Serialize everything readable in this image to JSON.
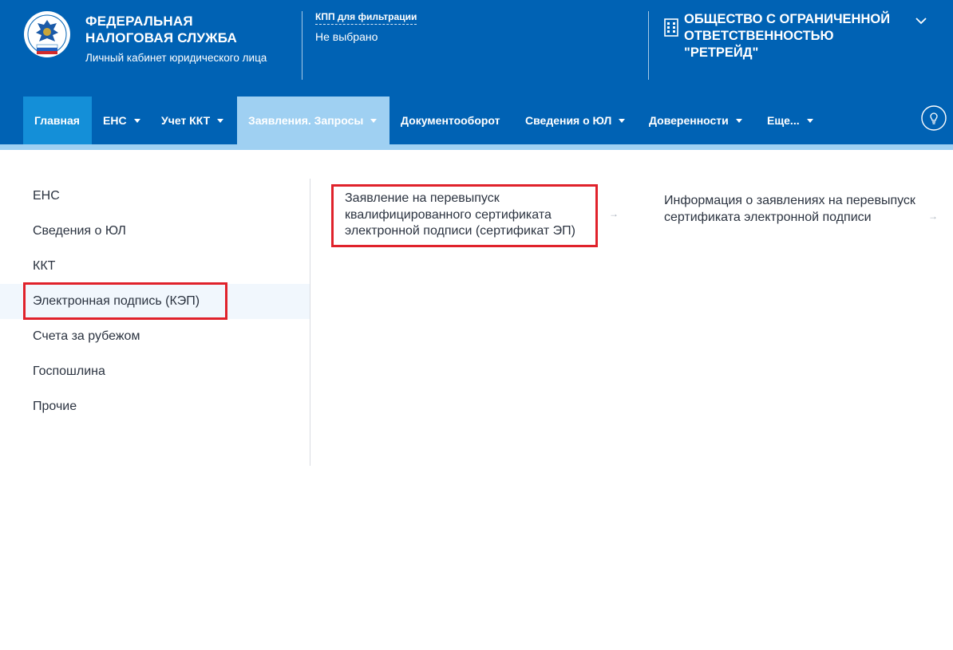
{
  "header": {
    "brand_title": "ФЕДЕРАЛЬНАЯ НАЛОГОВАЯ СЛУЖБА",
    "brand_subtitle": "Личный кабинет юридического лица",
    "kpp_label": "КПП для фильтрации",
    "kpp_value": "Не выбрано",
    "org_name": "ОБЩЕСТВО С ОГРАНИЧЕННОЙ ОТВЕТСТВЕННОСТЬЮ \"РЕТРЕЙД\"",
    "logo_icon": "fns-emblem-icon",
    "org_icon": "building-icon",
    "org_menu_icon": "chevron-down-icon"
  },
  "nav": {
    "items": [
      {
        "label": "Главная",
        "dropdown": false
      },
      {
        "label": "ЕНС",
        "dropdown": true
      },
      {
        "label": "Учет ККТ",
        "dropdown": true
      },
      {
        "label": "Заявления. Запросы",
        "dropdown": true
      },
      {
        "label": "Документооборот",
        "dropdown": false
      },
      {
        "label": "Сведения о ЮЛ",
        "dropdown": true
      },
      {
        "label": "Доверенности",
        "dropdown": true
      },
      {
        "label": "Еще...",
        "dropdown": true
      }
    ],
    "active": "Заявления. Запросы",
    "help_icon": "lightbulb-icon"
  },
  "left_menu": {
    "items": [
      {
        "label": "ЕНС"
      },
      {
        "label": "Сведения о ЮЛ"
      },
      {
        "label": "ККТ"
      },
      {
        "label": "Электронная подпись (КЭП)"
      },
      {
        "label": "Счета за рубежом"
      },
      {
        "label": "Госпошлина"
      },
      {
        "label": "Прочие"
      }
    ],
    "selected": "Электронная подпись (КЭП)"
  },
  "content": {
    "cards": [
      {
        "label": "Заявление на перевыпуск квалифицированного сертификата электронной подписи (сертификат ЭП)",
        "icon": "arrow-right-icon"
      },
      {
        "label": "Информация о заявлениях на перевыпуск сертификата электронной подписи",
        "icon": "arrow-right-icon"
      }
    ]
  },
  "colors": {
    "header_bg": "#0062b4",
    "nav_home_bg": "#148fd8",
    "nav_active_bg": "#9fd0f2",
    "highlight_border": "#e0222b"
  }
}
